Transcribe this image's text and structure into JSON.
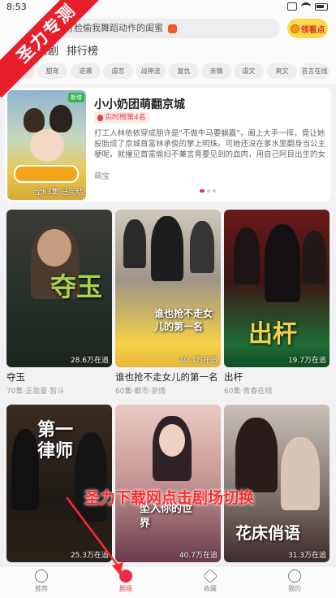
{
  "status": {
    "time": "8:53"
  },
  "corner_banner": "圣力专测",
  "search": {
    "placeholder": "打脸偷我舞蹈动作的闺蜜",
    "hot_icon": "hot-icon",
    "earn_label": "领看点",
    "earn_icon": "coin-icon"
  },
  "main_tabs": [
    "新剧",
    "排行榜"
  ],
  "sub_tabs": [
    "推荐",
    "甜宠",
    "逆袭",
    "虐恋",
    "战神流",
    "复仇",
    "亲情",
    "虐文",
    "爽文",
    "苔言在线"
  ],
  "featured": {
    "title": "小小奶团萌翻京城",
    "rank": "实时榜第4名",
    "description": "打工人林依依穿成朋许是\"不做牛马要躺赢\"，阖上大手一挥，竟让她投胎成了京城首富林承俊的掌上明珠。可她还没在爹水里翻身当公主梗呢，就撞见首富偷妇不兼言育要见到的血肉，用自己阿目出生的女儿去你找，换得她这样\"余招...",
    "genre": "萌宝",
    "badge": "新增",
    "episodes": "全63集 已完结"
  },
  "dramas": [
    {
      "title": "夺玉",
      "views": "28.6万在追",
      "meta": "70集·正能量·暂斗",
      "poster_text": "夺玉"
    },
    {
      "title": "谁也抢不走女儿的第一名",
      "views": "40.4万在追",
      "meta": "60集·都市·亲情",
      "poster_text": "谁也抢不走女儿的第一名"
    },
    {
      "title": "出杆",
      "views": "19.7万在追",
      "meta": "60集·青春在线",
      "poster_text": "出杆"
    },
    {
      "title": "",
      "views": "25.3万在追",
      "meta": "",
      "poster_text": "第一律师"
    },
    {
      "title": "",
      "views": "40.7万在追",
      "meta": "",
      "poster_text": "坠入你的世界"
    },
    {
      "title": "",
      "views": "31.3万在追",
      "meta": "",
      "poster_text": "花床俏语"
    }
  ],
  "overlay_annotation": "圣力下载网点击剧场切换",
  "bottom_nav": [
    {
      "label": "推荐",
      "icon": "recommend-icon",
      "active": false
    },
    {
      "label": "剧场",
      "icon": "theater-icon",
      "active": true
    },
    {
      "label": "收藏",
      "icon": "star-icon",
      "active": false
    },
    {
      "label": "我的",
      "icon": "profile-icon",
      "active": false
    }
  ],
  "colors": {
    "accent": "#ef2b4a",
    "earn_bg": "#ffd84d",
    "corner_red": "#e81f2a"
  }
}
